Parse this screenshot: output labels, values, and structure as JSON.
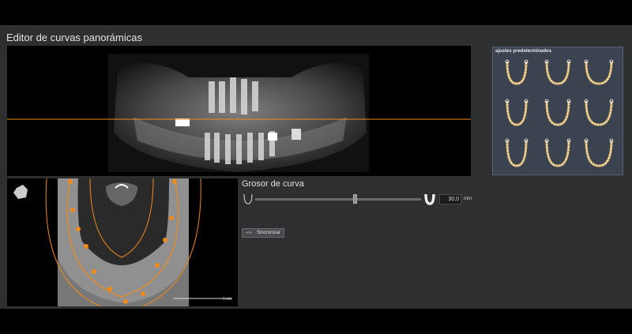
{
  "window": {
    "title": "Editor de curvas panorámicas"
  },
  "presets": {
    "title": "ajustes predeterminados",
    "count": 9
  },
  "thickness": {
    "label": "Grosor de curva",
    "value": "30,0",
    "unit": "mm",
    "slider_fraction": 0.6
  },
  "sync_button": {
    "label": "Sincronizar",
    "icon": "sync-arrows-icon"
  },
  "axial_view": {
    "scale_label": "5 cm"
  },
  "colors": {
    "curve": "#f08a1a",
    "background": "#2e2f31",
    "presets_bg": "#3b4350"
  }
}
